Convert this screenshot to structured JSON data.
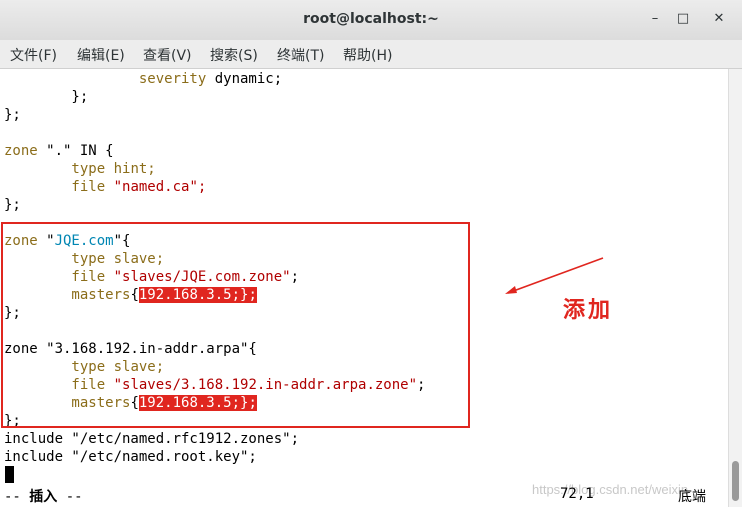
{
  "window": {
    "title": "root@localhost:~"
  },
  "menu": [
    "文件(F)",
    "编辑(E)",
    "查看(V)",
    "搜索(S)",
    "终端(T)",
    "帮助(H)"
  ],
  "lines": {
    "l1a": "                severity ",
    "l1b": "dynamic;",
    "l2": "        };",
    "l3": "};",
    "l5a": "zone",
    "l5b": " \".\" IN {",
    "l6a": "        type",
    "l6b": " hint;",
    "l7a": "        file",
    "l7b": " \"named.ca\";",
    "l8": "};",
    "l10a": "zone",
    "l10b": " \"",
    "l10c": "JQE.com",
    "l10d": "\"{",
    "l11a": "        type",
    "l11b": " slave;",
    "l12a": "        file",
    "l12b": " \"slaves/JQE.com.zone\"",
    "l12c": ";",
    "l13a": "        masters",
    "l13b": "{",
    "l13c": "192.168.3.5;};",
    "l14": "};",
    "l16": "zone \"3.168.192.in-addr.arpa\"{",
    "l17a": "        type",
    "l17b": " slave;",
    "l18a": "        file",
    "l18b": " \"slaves/3.168.192.in-addr.arpa.zone\"",
    "l18c": ";",
    "l19a": "        masters",
    "l19b": "{",
    "l19c": "192.168.3.5;};",
    "l20": "};",
    "l21": "include \"/etc/named.rfc1912.zones\";",
    "l22": "include \"/etc/named.root.key\";"
  },
  "status": {
    "mode_prefix": "-- ",
    "mode": "插入",
    "mode_suffix": " --",
    "position": "72,1",
    "scroll": "底端"
  },
  "watermark": "https://blog.csdn.net/weixin",
  "annotation": "添加",
  "colors": {
    "highlight": "#e0261f",
    "keyword": "#8b6d1a",
    "string": "#b00000"
  }
}
